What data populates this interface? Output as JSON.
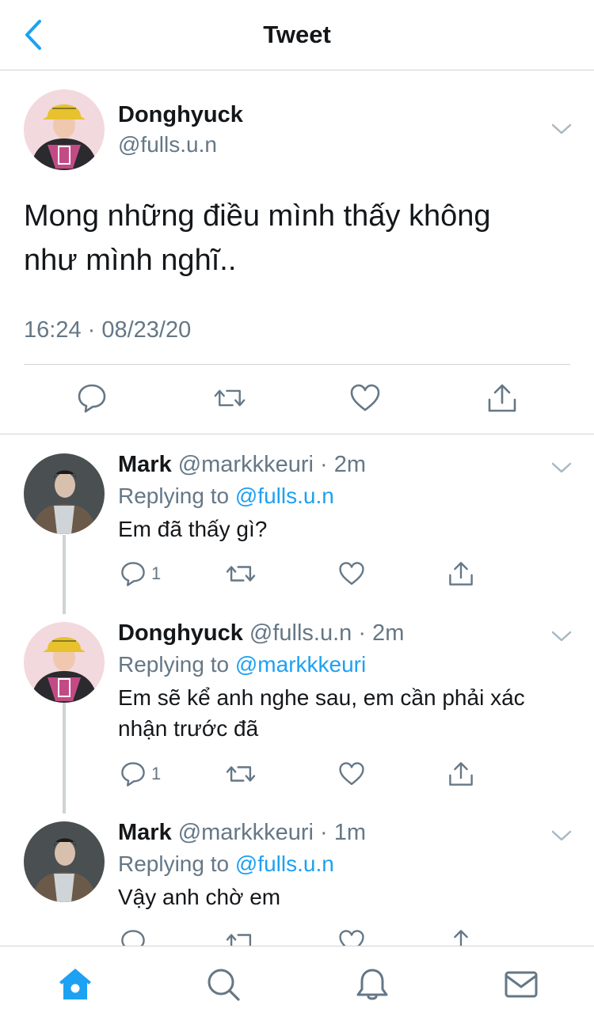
{
  "header": {
    "title": "Tweet"
  },
  "main_tweet": {
    "name": "Donghyuck",
    "handle": "@fulls.u.n",
    "text_line1": "Mong những điều mình thấy không",
    "text_line2": "như mình nghĩ..",
    "timestamp": "16:24 · 08/23/20"
  },
  "replies": [
    {
      "name": "Mark",
      "handle_time": "@markkkeuri · 2m",
      "replying_prefix": "Replying to",
      "replying_to": "@fulls.u.n",
      "text": "Em đã thấy gì?",
      "reply_count": "1"
    },
    {
      "name": "Donghyuck",
      "handle_time": "@fulls.u.n · 2m",
      "replying_prefix": "Replying to",
      "replying_to": "@markkkeuri",
      "text": "Em sẽ kể anh nghe sau, em cần phải xác nhận trước đã",
      "reply_count": "1"
    },
    {
      "name": "Mark",
      "handle_time": "@markkkeuri · 1m",
      "replying_prefix": "Replying to",
      "replying_to": "@fulls.u.n",
      "text": "Vậy anh chờ em",
      "reply_count": ""
    }
  ],
  "tabbar": {
    "items": [
      "home-icon",
      "search-icon",
      "notifications-icon",
      "messages-icon"
    ],
    "active": "home-icon"
  },
  "colors": {
    "accent": "#1da1f2",
    "secondary_text": "#657786",
    "divider": "#cfd3d6",
    "icon": "#657786"
  }
}
